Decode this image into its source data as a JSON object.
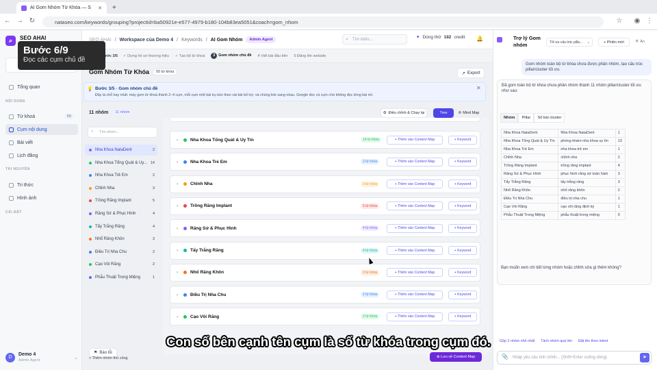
{
  "browser": {
    "tab_title": "AI Gom Nhóm Từ Khóa — S",
    "url": "nataseo.com/keywords/grouping?projectId=ba50921e-e577-4979-b180-104b83ea5051&coach=gom_nhom"
  },
  "sidebar": {
    "brand": "SEO AHAI",
    "step_overlay": {
      "title": "Bước 6/9",
      "subtitle": "Đọc các cụm chủ đề"
    },
    "overview": "Tổng quan",
    "section_content": "NỘI DUNG",
    "items": [
      {
        "label": "Từ khoá",
        "badge": "50"
      },
      {
        "label": "Cụm nội dung",
        "badge": ""
      },
      {
        "label": "Bài viết",
        "badge": ""
      },
      {
        "label": "Lịch đăng",
        "badge": ""
      }
    ],
    "section_resources": "TÀI NGUYÊN",
    "resources": [
      "Tri thức",
      "Hình ảnh"
    ],
    "section_settings": "CÀI ĐẶT",
    "user": {
      "initial": "D",
      "name": "Demo 4",
      "role": "Admin Agent"
    }
  },
  "header": {
    "crumb_app": "SEO AHAI",
    "crumb_workspace": "Workspace của Demo 4",
    "crumb_keywords": "Keywords",
    "crumb_current": "AI Gom Nhóm",
    "agent_badge": "Admin Agent",
    "search_placeholder": "Tìm kiếm...",
    "trial_label": "Dùng thử",
    "credit_value": "182",
    "credit_unit": "credit"
  },
  "stepper": {
    "progress": "Bước 3/5",
    "steps": [
      "Dựng hồ sơ thương hiệu",
      "Tạo bộ từ khoá"
    ],
    "current_num": "3",
    "current": "Gom nhóm chủ đề",
    "next": [
      "Viết bài đầu tiên",
      "Đăng lên website"
    ],
    "next_nums": [
      "4",
      "5"
    ]
  },
  "page": {
    "title": "Gom Nhóm Từ Khóa",
    "count_badge": "50 từ khóa",
    "export_label": "Export",
    "info_title": "Bước 3/5 · Gom nhóm chủ đề",
    "info_desc": "Đây là chỗ hay nhất: máy gom từ khoá thành 2–4 cụm, mỗi cụm một bài trụ kéo theo vài bài bổ trợ, và chúng link sang nhau. Google đọc cả cụm chứ không đọc từng bài rời."
  },
  "group_list": {
    "heading": "11 nhóm",
    "sub": "11 nhóm",
    "search_placeholder": "Tìm nhóm...",
    "groups": [
      {
        "name": "Nha Khoa NataDent",
        "count": "2",
        "color": "#8b5cf6"
      },
      {
        "name": "Nha Khoa Tổng Quát & Uy...",
        "count": "14",
        "color": "#22c55e"
      },
      {
        "name": "Nha Khoa Trẻ Em",
        "count": "2",
        "color": "#3b82f6"
      },
      {
        "name": "Chỉnh Nha",
        "count": "3",
        "color": "#f59e0b"
      },
      {
        "name": "Trồng Răng Implant",
        "count": "5",
        "color": "#ef4444"
      },
      {
        "name": "Răng Sứ & Phục Hình",
        "count": "4",
        "color": "#8b5cf6"
      },
      {
        "name": "Tẩy Trắng Răng",
        "count": "4",
        "color": "#14b8a6"
      },
      {
        "name": "Nhổ Răng Khôn",
        "count": "3",
        "color": "#f97316"
      },
      {
        "name": "Điều Trị Nha Chu",
        "count": "2",
        "color": "#3b82f6"
      },
      {
        "name": "Cạo Vôi Răng",
        "count": "2",
        "color": "#22c55e"
      },
      {
        "name": "Phẫu Thuật Trong Miệng",
        "count": "1",
        "color": "#6366f1"
      }
    ],
    "add_group": "Thêm nhóm thủ công",
    "report": "Báo lỗi"
  },
  "toolbar": {
    "adjust_label": "Điều chỉnh & Chạy lại",
    "tree_label": "Tree",
    "mindmap_label": "Mind Map"
  },
  "clusters": {
    "add_map_label": "+ Thêm vào Content Map",
    "add_kw_label": "+ Keyword",
    "items": [
      {
        "name": "Nha Khoa Tổng Quát & Uy Tín",
        "kw": "14 từ khóa",
        "color": "#22c55e"
      },
      {
        "name": "Nha Khoa Trẻ Em",
        "kw": "2 từ khóa",
        "color": "#3b82f6"
      },
      {
        "name": "Chỉnh Nha",
        "kw": "3 từ khóa",
        "color": "#f59e0b"
      },
      {
        "name": "Trồng Răng Implant",
        "kw": "5 từ khóa",
        "color": "#ef4444"
      },
      {
        "name": "Răng Sứ & Phục Hình",
        "kw": "4 từ khóa",
        "color": "#8b5cf6"
      },
      {
        "name": "Tẩy Trắng Răng",
        "kw": "4 từ khóa",
        "color": "#14b8a6"
      },
      {
        "name": "Nhổ Răng Khôn",
        "kw": "3 từ khóa",
        "color": "#f97316"
      },
      {
        "name": "Điều Trị Nha Chu",
        "kw": "2 từ khóa",
        "color": "#3b82f6"
      },
      {
        "name": "Cạo Vôi Răng",
        "kw": "2 từ khóa",
        "color": "#22c55e"
      },
      {
        "name": "Phẫu Thuật Trong Miệng",
        "kw": "",
        "color": "#6366f1"
      }
    ],
    "save_label": "Lưu về Content Map"
  },
  "assistant": {
    "title": "Trợ lý Gom nhóm",
    "select": "Tối ưu cấu trúc pilla...",
    "new_session": "+ Phiên mới",
    "close": "Ẩn",
    "user_msg": "Gom nhóm toàn bộ từ khóa chưa được phân nhóm, tạo cấu trúc pillar/cluster tối ưu.",
    "bot_intro": "Đã gom toàn bộ từ khóa chưa phân nhóm thành 11 nhóm pillar/cluster tối ưu như sau:",
    "table_headers": [
      "Nhóm",
      "Pillar",
      "Số bài cluster"
    ],
    "rows": [
      [
        "Nha Khoa NataDent",
        "Nha Khoa NataDent",
        "1"
      ],
      [
        "Nha Khoa Tổng Quát & Uy Tín",
        "phòng khám nha khoa uy tín",
        "13"
      ],
      [
        "Nha Khoa Trẻ Em",
        "nha khoa trẻ em",
        "1"
      ],
      [
        "Chỉnh Nha",
        "chỉnh nha",
        "2"
      ],
      [
        "Trồng Răng Implant",
        "trồng răng implant",
        "4"
      ],
      [
        "Răng Sứ & Phục Hình",
        "phục hình răng sứ toàn hàm",
        "3"
      ],
      [
        "Tẩy Trắng Răng",
        "tẩy trắng răng",
        "3"
      ],
      [
        "Nhổ Răng Khôn",
        "nhổ răng khôn",
        "2"
      ],
      [
        "Điều Trị Nha Chu",
        "điều trị nha chu",
        "1"
      ],
      [
        "Cạo Vôi Răng",
        "cạo vôi răng định kỳ",
        "1"
      ],
      [
        "Phẫu Thuật Trong Miệng",
        "phẫu thuật trong miệng",
        "0"
      ]
    ],
    "bot_outro": "Bạn muốn xem chi tiết từng nhóm hoặc chỉnh sửa gì thêm không?",
    "chips": [
      "Gộp 2 nhóm nhỏ nhất",
      "Tách nhóm quá lớn",
      "Đặt tên theo intent"
    ],
    "input_placeholder": "Nhập yêu cầu tinh chỉnh... (Shift+Enter xuống dòng)"
  },
  "caption": "Con số bên cạnh tên cụm là số từ khóa trong cụm đó."
}
